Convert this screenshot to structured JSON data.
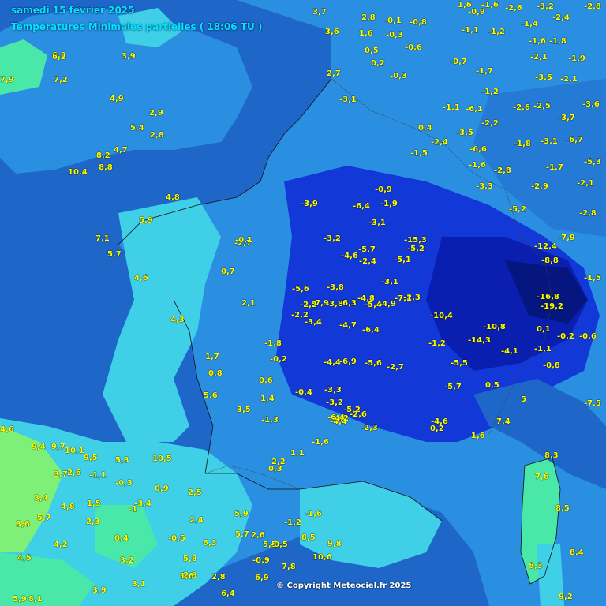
{
  "header": {
    "title": "samedi 15 février 2025",
    "subtitle": "Températures Minimales partielles ( 18:06 TU )"
  },
  "footer": {
    "copyright": "© Copyright Meteociel.fr 2025"
  },
  "colors": {
    "sea": "#1e66c8",
    "deep_cold": "#1238d8",
    "very_cold": "#0a1fb0",
    "cool_land": "#2a8fe0",
    "mild": "#3fd0e8",
    "warm": "#49e8a8",
    "warmest": "#7ef07a",
    "label_yellow": "#ffff00",
    "title_cyan": "#00e5ff"
  },
  "stations": [
    {
      "v": "1,6"
    },
    {
      "v": "-1,6"
    },
    {
      "v": "-2,6"
    },
    {
      "v": "-3,2"
    },
    {
      "v": "-2,8"
    },
    {
      "v": "3,7"
    },
    {
      "v": "2,8"
    },
    {
      "v": "-0,1"
    },
    {
      "v": "-0,8"
    },
    {
      "v": "-0,9"
    },
    {
      "v": "3,6"
    },
    {
      "v": "1,6"
    },
    {
      "v": "-0,3"
    },
    {
      "v": "-1,1"
    },
    {
      "v": "-1,2"
    },
    {
      "v": "-1,4"
    },
    {
      "v": "-2,4"
    },
    {
      "v": "6,2"
    },
    {
      "v": "3,9"
    },
    {
      "v": "0,5"
    },
    {
      "v": "0,2"
    },
    {
      "v": "-0,6"
    },
    {
      "v": "-1,6"
    },
    {
      "v": "-1,8"
    },
    {
      "v": "-2,1"
    },
    {
      "v": "-1,9"
    },
    {
      "v": "7,9"
    },
    {
      "v": "2,7"
    },
    {
      "v": "-0,3"
    },
    {
      "v": "-0,7"
    },
    {
      "v": "-1,7"
    },
    {
      "v": "-3,5"
    },
    {
      "v": "-2,1"
    },
    {
      "v": "4,9"
    },
    {
      "v": "-3,1"
    },
    {
      "v": "-1,2"
    },
    {
      "v": "-2,5"
    },
    {
      "v": "-3,6"
    },
    {
      "v": "2,9"
    },
    {
      "v": "-1,1"
    },
    {
      "v": "-6,1"
    },
    {
      "v": "-2,6"
    },
    {
      "v": "-3,7"
    },
    {
      "v": "5,4"
    },
    {
      "v": "0,4"
    },
    {
      "v": "-2,4"
    },
    {
      "v": "-3,5"
    },
    {
      "v": "-2,2"
    },
    {
      "v": "-6,7"
    },
    {
      "v": "2,8"
    },
    {
      "v": "-1,5"
    },
    {
      "v": "-6,6"
    },
    {
      "v": "-1,8"
    },
    {
      "v": "4,7"
    },
    {
      "v": "-3,1"
    },
    {
      "v": "-5,3"
    },
    {
      "v": "8,2"
    },
    {
      "v": "8,8"
    },
    {
      "v": "-1,6"
    },
    {
      "v": "-2,8"
    },
    {
      "v": "-1,7"
    },
    {
      "v": "10,4"
    },
    {
      "v": "-3,3"
    },
    {
      "v": "-0,9"
    },
    {
      "v": "-2,9"
    },
    {
      "v": "-2,1"
    },
    {
      "v": "4,8"
    },
    {
      "v": "-3,9"
    },
    {
      "v": "-6,4"
    },
    {
      "v": "-1,9"
    },
    {
      "v": "-5,2"
    },
    {
      "v": "-2,8"
    },
    {
      "v": "5,9"
    },
    {
      "v": "-3,2"
    },
    {
      "v": "-3,1"
    },
    {
      "v": "-5,2"
    },
    {
      "v": "-7,9"
    },
    {
      "v": "7,1"
    },
    {
      "v": "-2,7"
    },
    {
      "v": "-5,7"
    },
    {
      "v": "-12,4"
    },
    {
      "v": "5,7"
    },
    {
      "v": "-4,6"
    },
    {
      "v": "-5,1"
    },
    {
      "v": "-8,8"
    },
    {
      "v": "4,6"
    },
    {
      "v": "-3,8"
    },
    {
      "v": "-15,3"
    },
    {
      "v": "-1,5"
    },
    {
      "v": "-5,6"
    },
    {
      "v": "-3,1"
    },
    {
      "v": "-7,9"
    },
    {
      "v": "-6,3"
    },
    {
      "v": "-4,8"
    },
    {
      "v": "-2,3"
    },
    {
      "v": "-16,8"
    },
    {
      "v": "4,3"
    },
    {
      "v": "-2,2"
    },
    {
      "v": "-10,4"
    },
    {
      "v": "-19,2"
    },
    {
      "v": "-4,7"
    },
    {
      "v": "-6,4"
    },
    {
      "v": "-10,8"
    },
    {
      "v": "0,1"
    },
    {
      "v": "-0,2"
    },
    {
      "v": "-0,6"
    },
    {
      "v": "-4,1"
    },
    {
      "v": "-1,1"
    },
    {
      "v": "-14,3"
    },
    {
      "v": "-4,4"
    },
    {
      "v": "-6,9"
    },
    {
      "v": "-5,6"
    },
    {
      "v": "-2,7"
    },
    {
      "v": "-0,8"
    },
    {
      "v": "-3,3"
    },
    {
      "v": "-5,5"
    },
    {
      "v": "-3,2"
    },
    {
      "v": "-5,7"
    },
    {
      "v": "-1,2"
    },
    {
      "v": "0,5"
    },
    {
      "v": "5,6"
    },
    {
      "v": "-0,4"
    },
    {
      "v": "-5,2"
    },
    {
      "v": "-4,4"
    },
    {
      "v": "-4,6"
    },
    {
      "v": "5"
    },
    {
      "v": "-7,5"
    },
    {
      "v": "-2,3"
    },
    {
      "v": "-6,4"
    },
    {
      "v": "0,2"
    },
    {
      "v": "7,4"
    },
    {
      "v": "1,6"
    },
    {
      "v": "4,6"
    },
    {
      "v": "9,4"
    },
    {
      "v": "9,7"
    },
    {
      "v": "10,1"
    },
    {
      "v": "-1,6"
    },
    {
      "v": "8,3"
    },
    {
      "v": "9,5"
    },
    {
      "v": "5,3"
    },
    {
      "v": "10,5"
    },
    {
      "v": "3,7"
    },
    {
      "v": "2,6"
    },
    {
      "v": "-1,1"
    },
    {
      "v": "-0,3"
    },
    {
      "v": "0,9"
    },
    {
      "v": "2,5"
    },
    {
      "v": "5,9"
    },
    {
      "v": "2,4"
    },
    {
      "v": "3,4"
    },
    {
      "v": "4,8"
    },
    {
      "v": "1,5"
    },
    {
      "v": "-3,4"
    },
    {
      "v": "3,6"
    },
    {
      "v": "5,7"
    },
    {
      "v": "2,3"
    },
    {
      "v": "-1"
    },
    {
      "v": "0,4"
    },
    {
      "v": "-0,5"
    },
    {
      "v": "6,3"
    },
    {
      "v": "5,7"
    },
    {
      "v": "2,6"
    },
    {
      "v": "5,5"
    },
    {
      "v": "8,5"
    },
    {
      "v": "9,8"
    },
    {
      "v": "10,6"
    },
    {
      "v": "4,2"
    },
    {
      "v": "3,2"
    },
    {
      "v": "-2,9"
    },
    {
      "v": "2,8"
    },
    {
      "v": "6,9"
    },
    {
      "v": "7,8"
    },
    {
      "v": "4,5"
    },
    {
      "v": "3,9"
    },
    {
      "v": "3,1"
    },
    {
      "v": "8,4"
    },
    {
      "v": "8,3"
    },
    {
      "v": "9,2"
    },
    {
      "v": "5,9"
    },
    {
      "v": "8,1"
    },
    {
      "v": "7,6"
    },
    {
      "v": "8,5"
    },
    {
      "v": "6,4"
    },
    {
      "v": "5,8"
    },
    {
      "v": "1,6"
    },
    {
      "v": "-0,9"
    },
    {
      "v": "-0,5"
    },
    {
      "v": "-1,2"
    },
    {
      "v": "-1,6"
    },
    {
      "v": "0,3"
    },
    {
      "v": "2,2"
    },
    {
      "v": "1,1"
    },
    {
      "v": "6,2"
    },
    {
      "v": "7,2"
    },
    {
      "v": "-2,4"
    },
    {
      "v": "-3,8"
    },
    {
      "v": "-6,3"
    },
    {
      "v": "-5,4"
    },
    {
      "v": "-4,9"
    },
    {
      "v": "-7,1"
    },
    {
      "v": "-2,2"
    },
    {
      "v": "-3,4"
    },
    {
      "v": "-1,8"
    },
    {
      "v": "-0,2"
    },
    {
      "v": "0,6"
    },
    {
      "v": "1,4"
    },
    {
      "v": "3,5"
    },
    {
      "v": "-1,3"
    },
    {
      "v": "-4,2"
    },
    {
      "v": "-2,6"
    },
    {
      "v": "0,8"
    },
    {
      "v": "1,7"
    },
    {
      "v": "2,1"
    },
    {
      "v": "-0,1"
    },
    {
      "v": "0,7"
    }
  ]
}
